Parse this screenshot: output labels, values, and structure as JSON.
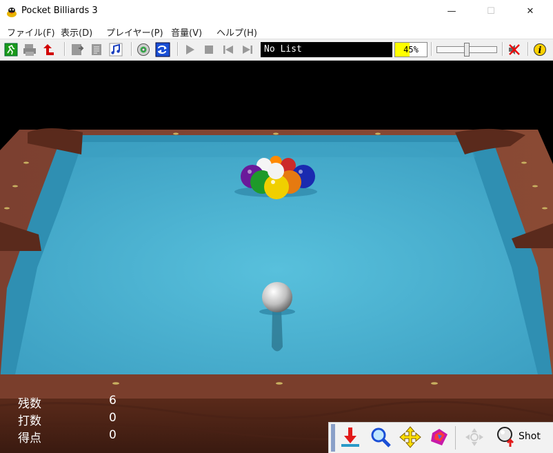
{
  "window": {
    "title": "Pocket Billiards 3",
    "minimize_glyph": "—",
    "maximize_glyph": "☐",
    "close_glyph": "✕"
  },
  "menu": [
    {
      "label": "ファイル(F)"
    },
    {
      "label": "表示(D)"
    },
    {
      "label": "プレイヤー(P)"
    },
    {
      "label": "音量(V)"
    },
    {
      "label": "ヘルプ(H)"
    }
  ],
  "toolbar": {
    "icons": [
      "exit-icon",
      "print-icon",
      "undo-icon",
      "import-icon",
      "notes-icon",
      "music-icon",
      "cd-icon",
      "repeat-icon",
      "play-icon",
      "stop-icon",
      "previous-icon",
      "next-icon",
      "mute-icon",
      "info-icon"
    ],
    "playlist": "No List",
    "volume_text": "45%",
    "volume_level": 45
  },
  "stats": [
    {
      "label": "残数",
      "value": "6"
    },
    {
      "label": "打数",
      "value": "0"
    },
    {
      "label": "得点",
      "value": "0"
    }
  ],
  "control_panel": {
    "icons": [
      "place-ball-icon",
      "zoom-icon",
      "move-view-icon",
      "rotate-view-icon",
      "aim-direction-icon",
      "shot-icon"
    ],
    "shot_label": "Shot"
  },
  "colors": {
    "cloth": "#4fb6d3",
    "rail": "#7a3b25",
    "background": "#000000",
    "volume_fill": "#ffff00"
  }
}
